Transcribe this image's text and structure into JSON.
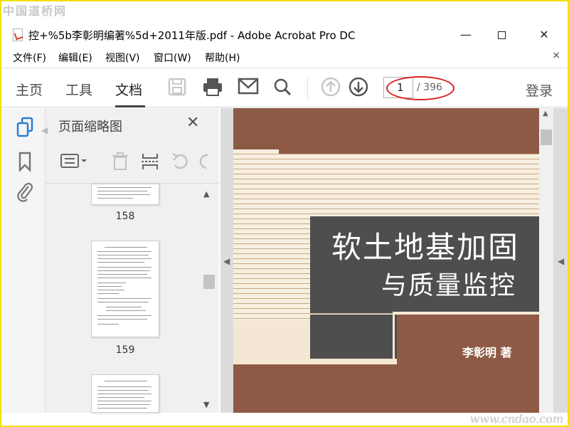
{
  "watermark": {
    "top_left": "中国道桥网",
    "bottom_right": "www.cndao.com"
  },
  "window": {
    "title": "控+%5b李彰明编著%5d+2011年版.pdf - Adobe Acrobat Pro DC",
    "minimize": "—",
    "close": "✕"
  },
  "menu": {
    "items": [
      "文件(F)",
      "编辑(E)",
      "视图(V)",
      "窗口(W)",
      "帮助(H)"
    ],
    "close": "×"
  },
  "toolbar": {
    "tabs": [
      "主页",
      "工具",
      "文档"
    ],
    "active_tab": "文档",
    "icons": {
      "save": "save-icon",
      "print": "print-icon",
      "mail": "mail-icon",
      "search": "search-icon",
      "page_up": "arrow-up-circle-icon",
      "page_down": "arrow-down-circle-icon"
    },
    "page_current": "1",
    "page_total": "/ 396",
    "login": "登录",
    "highlight_color": "#d81e1e"
  },
  "sidebar": {
    "panel_title": "页面缩略图",
    "thumbnails": [
      {
        "label": "158"
      },
      {
        "label": "159"
      }
    ]
  },
  "document": {
    "cover_title_line1": "软土地基加固",
    "cover_title_line2": "与质量监控",
    "cover_author": "李彰明  著",
    "cover_colors": {
      "brown": "#8f5a45",
      "dark": "#4e4e4e",
      "cream": "#f4e8d4"
    }
  }
}
